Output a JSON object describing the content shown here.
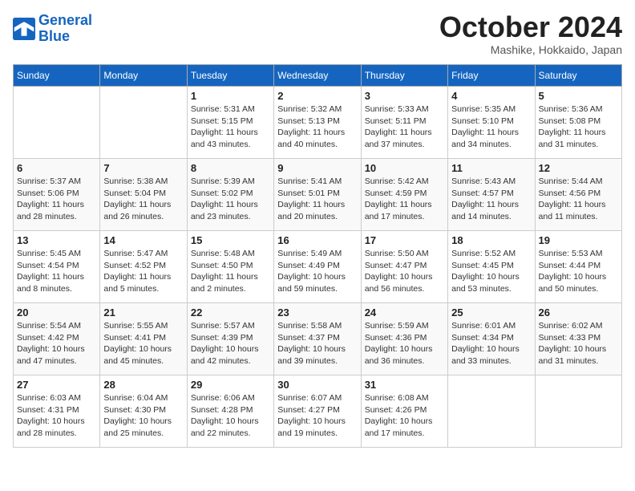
{
  "logo": {
    "line1": "General",
    "line2": "Blue"
  },
  "title": "October 2024",
  "location": "Mashike, Hokkaido, Japan",
  "days_header": [
    "Sunday",
    "Monday",
    "Tuesday",
    "Wednesday",
    "Thursday",
    "Friday",
    "Saturday"
  ],
  "weeks": [
    [
      {
        "day": "",
        "text": ""
      },
      {
        "day": "",
        "text": ""
      },
      {
        "day": "1",
        "text": "Sunrise: 5:31 AM\nSunset: 5:15 PM\nDaylight: 11 hours and 43 minutes."
      },
      {
        "day": "2",
        "text": "Sunrise: 5:32 AM\nSunset: 5:13 PM\nDaylight: 11 hours and 40 minutes."
      },
      {
        "day": "3",
        "text": "Sunrise: 5:33 AM\nSunset: 5:11 PM\nDaylight: 11 hours and 37 minutes."
      },
      {
        "day": "4",
        "text": "Sunrise: 5:35 AM\nSunset: 5:10 PM\nDaylight: 11 hours and 34 minutes."
      },
      {
        "day": "5",
        "text": "Sunrise: 5:36 AM\nSunset: 5:08 PM\nDaylight: 11 hours and 31 minutes."
      }
    ],
    [
      {
        "day": "6",
        "text": "Sunrise: 5:37 AM\nSunset: 5:06 PM\nDaylight: 11 hours and 28 minutes."
      },
      {
        "day": "7",
        "text": "Sunrise: 5:38 AM\nSunset: 5:04 PM\nDaylight: 11 hours and 26 minutes."
      },
      {
        "day": "8",
        "text": "Sunrise: 5:39 AM\nSunset: 5:02 PM\nDaylight: 11 hours and 23 minutes."
      },
      {
        "day": "9",
        "text": "Sunrise: 5:41 AM\nSunset: 5:01 PM\nDaylight: 11 hours and 20 minutes."
      },
      {
        "day": "10",
        "text": "Sunrise: 5:42 AM\nSunset: 4:59 PM\nDaylight: 11 hours and 17 minutes."
      },
      {
        "day": "11",
        "text": "Sunrise: 5:43 AM\nSunset: 4:57 PM\nDaylight: 11 hours and 14 minutes."
      },
      {
        "day": "12",
        "text": "Sunrise: 5:44 AM\nSunset: 4:56 PM\nDaylight: 11 hours and 11 minutes."
      }
    ],
    [
      {
        "day": "13",
        "text": "Sunrise: 5:45 AM\nSunset: 4:54 PM\nDaylight: 11 hours and 8 minutes."
      },
      {
        "day": "14",
        "text": "Sunrise: 5:47 AM\nSunset: 4:52 PM\nDaylight: 11 hours and 5 minutes."
      },
      {
        "day": "15",
        "text": "Sunrise: 5:48 AM\nSunset: 4:50 PM\nDaylight: 11 hours and 2 minutes."
      },
      {
        "day": "16",
        "text": "Sunrise: 5:49 AM\nSunset: 4:49 PM\nDaylight: 10 hours and 59 minutes."
      },
      {
        "day": "17",
        "text": "Sunrise: 5:50 AM\nSunset: 4:47 PM\nDaylight: 10 hours and 56 minutes."
      },
      {
        "day": "18",
        "text": "Sunrise: 5:52 AM\nSunset: 4:45 PM\nDaylight: 10 hours and 53 minutes."
      },
      {
        "day": "19",
        "text": "Sunrise: 5:53 AM\nSunset: 4:44 PM\nDaylight: 10 hours and 50 minutes."
      }
    ],
    [
      {
        "day": "20",
        "text": "Sunrise: 5:54 AM\nSunset: 4:42 PM\nDaylight: 10 hours and 47 minutes."
      },
      {
        "day": "21",
        "text": "Sunrise: 5:55 AM\nSunset: 4:41 PM\nDaylight: 10 hours and 45 minutes."
      },
      {
        "day": "22",
        "text": "Sunrise: 5:57 AM\nSunset: 4:39 PM\nDaylight: 10 hours and 42 minutes."
      },
      {
        "day": "23",
        "text": "Sunrise: 5:58 AM\nSunset: 4:37 PM\nDaylight: 10 hours and 39 minutes."
      },
      {
        "day": "24",
        "text": "Sunrise: 5:59 AM\nSunset: 4:36 PM\nDaylight: 10 hours and 36 minutes."
      },
      {
        "day": "25",
        "text": "Sunrise: 6:01 AM\nSunset: 4:34 PM\nDaylight: 10 hours and 33 minutes."
      },
      {
        "day": "26",
        "text": "Sunrise: 6:02 AM\nSunset: 4:33 PM\nDaylight: 10 hours and 31 minutes."
      }
    ],
    [
      {
        "day": "27",
        "text": "Sunrise: 6:03 AM\nSunset: 4:31 PM\nDaylight: 10 hours and 28 minutes."
      },
      {
        "day": "28",
        "text": "Sunrise: 6:04 AM\nSunset: 4:30 PM\nDaylight: 10 hours and 25 minutes."
      },
      {
        "day": "29",
        "text": "Sunrise: 6:06 AM\nSunset: 4:28 PM\nDaylight: 10 hours and 22 minutes."
      },
      {
        "day": "30",
        "text": "Sunrise: 6:07 AM\nSunset: 4:27 PM\nDaylight: 10 hours and 19 minutes."
      },
      {
        "day": "31",
        "text": "Sunrise: 6:08 AM\nSunset: 4:26 PM\nDaylight: 10 hours and 17 minutes."
      },
      {
        "day": "",
        "text": ""
      },
      {
        "day": "",
        "text": ""
      }
    ]
  ]
}
